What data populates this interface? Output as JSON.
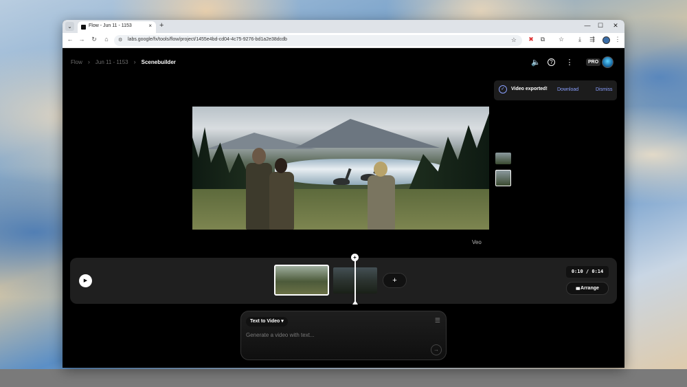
{
  "browser": {
    "tab_title": "Flow - Jun 11 - 1153",
    "url": "labs.google/fx/tools/flow/project/1455e4bd-cd04-4c75-9276-bd1a2e38dcdb",
    "new_tab": "+",
    "tab_close": "×",
    "tab_dropdown": "⌄",
    "win_min": "—",
    "win_max": "☐",
    "win_close": "✕",
    "nav": {
      "back": "←",
      "forward": "→",
      "reload": "↻",
      "home": "⌂"
    },
    "toolbar_icons": {
      "star": "☆",
      "extension_red": "✖",
      "puzzle": "⧉",
      "bookmark": "☆",
      "download": "⤓",
      "cast": "⇶",
      "menu": "⋮",
      "site_info": "⚙"
    }
  },
  "header": {
    "breadcrumb": [
      "Flow",
      "Jun 11 - 1153",
      "Scenebuilder"
    ],
    "sep": "›",
    "pro_badge": "PRO",
    "icons": {
      "speaker": "🔈",
      "help": "?",
      "more": "⋮"
    }
  },
  "toast": {
    "message": "Video exported!",
    "download_label": "Download",
    "dismiss_label": "Dismiss",
    "check": "✓"
  },
  "video_label": "Veo",
  "timeline": {
    "play": "▶",
    "add_clip": "+",
    "playhead": "+",
    "timecode": "0:10 / 0:14",
    "arrange_label": "Arrange",
    "arrange_icon": "▮▮▮"
  },
  "prompt": {
    "mode_label": "Text to Video",
    "mode_caret": "▾",
    "placeholder": "Generate a video with text...",
    "settings_icon": "☰",
    "send_icon": "→"
  }
}
